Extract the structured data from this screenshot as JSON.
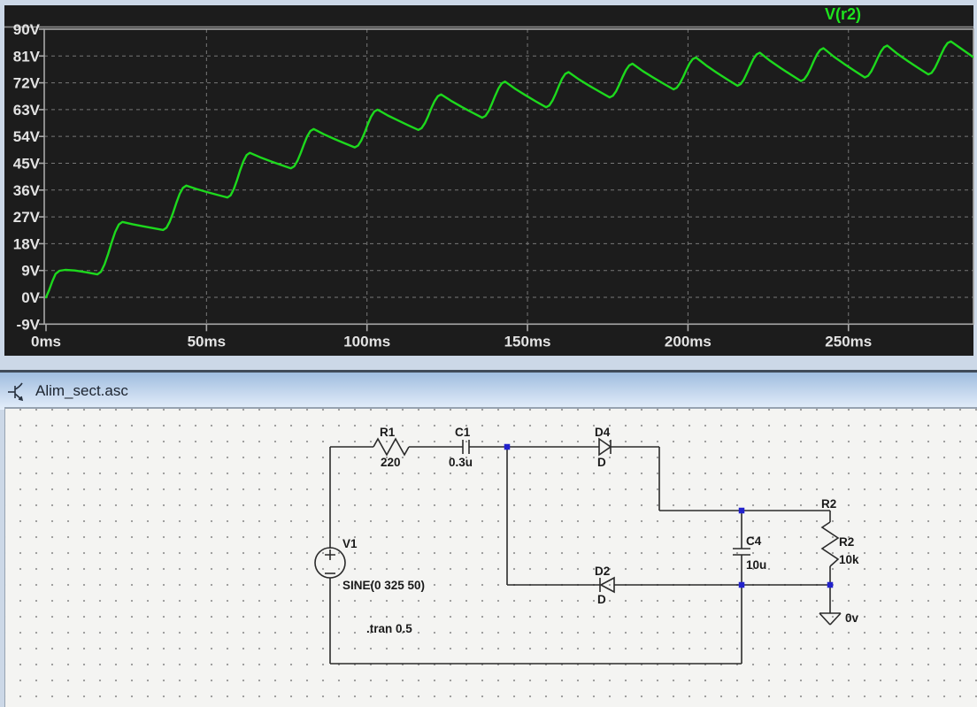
{
  "chart_data": {
    "type": "line",
    "title": "",
    "grid": "dashed",
    "legend_position": "top-right",
    "legend": [
      {
        "label": "V(r2)",
        "color": "#1ee41e"
      }
    ],
    "x_axis": {
      "unit": "ms",
      "min": 0,
      "max": 290,
      "ticks": [
        0,
        50,
        100,
        150,
        200,
        250
      ],
      "tick_labels": [
        "0ms",
        "50ms",
        "100ms",
        "150ms",
        "200ms",
        "250ms"
      ]
    },
    "y_axis": {
      "unit": "V",
      "min": -9,
      "max": 90,
      "ticks": [
        90,
        81,
        72,
        63,
        54,
        45,
        36,
        27,
        18,
        9,
        0,
        -9
      ],
      "tick_labels": [
        "90V",
        "81V",
        "72V",
        "63V",
        "54V",
        "45V",
        "36V",
        "27V",
        "18V",
        "9V",
        "0V",
        "-9V"
      ]
    },
    "series": [
      {
        "name": "V(r2)",
        "color": "#1dd91d",
        "description": "Capacitor charging curve with 50 Hz ripple, start/peaks/troughs in [ms, volts]",
        "start_points": [
          [
            0,
            0
          ],
          [
            1,
            2.5
          ],
          [
            2,
            5.5
          ],
          [
            3,
            7.9
          ],
          [
            4.2,
            8.9
          ],
          [
            6,
            9.2
          ],
          [
            9,
            9.0
          ],
          [
            12.5,
            8.4
          ],
          [
            16,
            7.7
          ]
        ],
        "peaks": [
          [
            23.8,
            25.3
          ],
          [
            43.7,
            37.5
          ],
          [
            63.5,
            48.5
          ],
          [
            83.4,
            56.5
          ],
          [
            103.3,
            63.0
          ],
          [
            123.1,
            68.1
          ],
          [
            143.0,
            72.4
          ],
          [
            162.8,
            75.6
          ],
          [
            182.7,
            78.4
          ],
          [
            202.5,
            80.5
          ],
          [
            222.4,
            82.1
          ],
          [
            242.2,
            83.6
          ],
          [
            262.1,
            84.5
          ],
          [
            281.9,
            85.9
          ]
        ],
        "troughs": [
          [
            36.5,
            22.6
          ],
          [
            56.5,
            33.5
          ],
          [
            76.3,
            43.3
          ],
          [
            96.2,
            50.3
          ],
          [
            116.0,
            56.2
          ],
          [
            135.9,
            60.3
          ],
          [
            155.8,
            63.8
          ],
          [
            175.6,
            67.1
          ],
          [
            195.5,
            69.8
          ],
          [
            215.4,
            71.0
          ],
          [
            235.2,
            72.6
          ],
          [
            255.1,
            73.8
          ],
          [
            274.9,
            74.8
          ]
        ],
        "end_point": [
          290,
          79.8
        ]
      }
    ]
  },
  "schematic": {
    "title": "Alim_sect.asc",
    "components": [
      {
        "ref": "R1",
        "value": "220"
      },
      {
        "ref": "C1",
        "value": "0.3u"
      },
      {
        "ref": "D4",
        "value": "D"
      },
      {
        "ref": "D2",
        "value": "D"
      },
      {
        "ref": "V1",
        "value": "SINE(0 325 50)"
      },
      {
        "ref": "C4",
        "value": "10u"
      },
      {
        "ref": "R2",
        "value": "10k"
      }
    ],
    "net_label_r2": "R2",
    "ground_label": "0v",
    "directive": ".tran 0.5",
    "junction_color": "#2222cc",
    "ground_label_color": "#2222cc"
  }
}
